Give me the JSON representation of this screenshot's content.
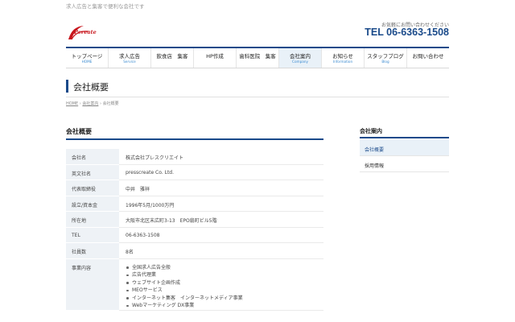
{
  "header": {
    "tagline": "求人広告と集客で便利な会社です",
    "logo_text": "Pcreate",
    "contact_label": "お気軽にお問い合わせください",
    "tel": "TEL 06-6363-1508"
  },
  "nav": {
    "items": [
      {
        "ja": "トップページ",
        "en": "HOME"
      },
      {
        "ja": "求人広告",
        "en": "Service"
      },
      {
        "ja": "飲食店　集客",
        "en": ""
      },
      {
        "ja": "HP作成",
        "en": ""
      },
      {
        "ja": "歯科医院　集客",
        "en": ""
      },
      {
        "ja": "会社案内",
        "en": "Company"
      },
      {
        "ja": "お知らせ",
        "en": "Information"
      },
      {
        "ja": "スタッフブログ",
        "en": "Blog"
      },
      {
        "ja": "お問い合わせ",
        "en": ""
      }
    ]
  },
  "page": {
    "title": "会社概要",
    "breadcrumb": {
      "home": "HOME",
      "sep": "›",
      "parent": "会社案内",
      "current": "会社概要"
    }
  },
  "main": {
    "section_title": "会社概要",
    "rows": [
      {
        "key": "会社名",
        "value": "株式会社プレスクリエイト"
      },
      {
        "key": "英文社名",
        "value": "presscreate Co. Ltd."
      },
      {
        "key": "代表取締役",
        "value": "中井　雅祥"
      },
      {
        "key": "設立/資本金",
        "value": "1996年5月/1000万円"
      },
      {
        "key": "所在地",
        "value": "大阪市北区末広町3-13　EPO扇町ビル5階"
      },
      {
        "key": "TEL",
        "value": "06-6363-1508"
      },
      {
        "key": "社員数",
        "value": "8名"
      }
    ],
    "business": {
      "key": "事業内容",
      "items": [
        "全国求人広告全般",
        "広告代理業",
        "ウェブサイト企画作成",
        "MEOサービス",
        "インターネット集客　インターネットメディア事業",
        "Webマーケティング DX事業"
      ]
    }
  },
  "sidebar": {
    "title": "会社案内",
    "items": [
      {
        "label": "会社概要"
      },
      {
        "label": "採用情報"
      }
    ]
  },
  "colors": {
    "brand": "#1a4a8a",
    "logo": "#c8161d",
    "accent_bg": "#e9f1f8"
  }
}
